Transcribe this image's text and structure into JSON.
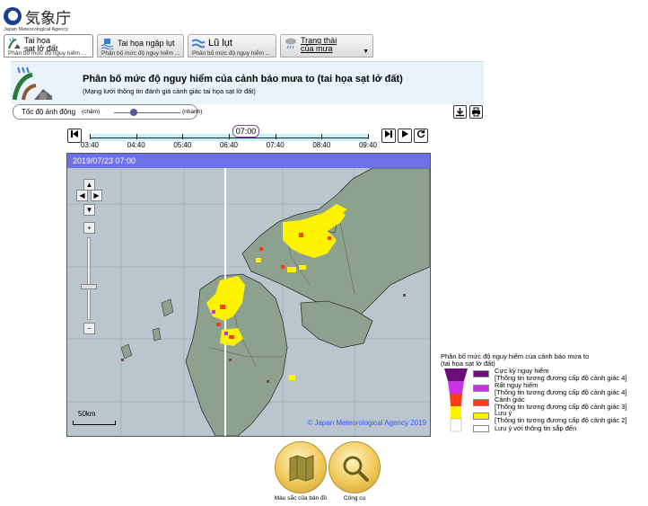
{
  "header": {
    "logo_jp": "気象庁",
    "logo_en": "Japan Meteorological Agency"
  },
  "tabs": [
    {
      "title_line1": "Tai họa",
      "title_line2": "sạt lở đất",
      "sub": "Phân bố mức độ nguy hiểm ...",
      "active": true
    },
    {
      "title": "Tai họa ngập lụt",
      "sub": "Phân bố mức độ nguy hiểm ..."
    },
    {
      "title": "Lũ lụt",
      "sub": "Phân bố mức độ nguy hiểm ..."
    },
    {
      "title_line1": "Trạng thái",
      "title_line2": "của mưa",
      "arrow": "▼"
    }
  ],
  "page": {
    "title": "Phân bố mức độ nguy hiểm của cảnh báo mưa to (tai họa sạt lở đất)",
    "subtitle": "(Mạng lưới thông tin đánh giá cảnh giác tai họa sạt lở đất)"
  },
  "speed": {
    "label": "Tốc độ ảnh động",
    "slow": "(chậm)",
    "fast": "(nhanh)",
    "level": 0.3
  },
  "toolbar": {
    "download_icon": "download-icon",
    "print_icon": "print-icon"
  },
  "timeline": {
    "current": "07:00",
    "ticks": [
      "03:40",
      "04:40",
      "05:40",
      "06:40",
      "07:40",
      "08:40",
      "09:40"
    ],
    "buttons": {
      "first": "first-frame-icon",
      "last": "last-frame-icon",
      "play": "play-icon",
      "refresh": "refresh-icon"
    }
  },
  "map": {
    "datetime": "2019/07/23 07:00",
    "copyright": "© Japan Meteorological Agency 2019",
    "scale": "50km",
    "zoom_in": "+",
    "zoom_out": "−",
    "zoom_level": 0.6
  },
  "legend": {
    "title_line1": "Phân bố mức độ nguy hiểm của cảnh báo mưa to",
    "title_line2": "(tai họa sạt lở đất)",
    "items": [
      {
        "label": "Cực kỳ nguy hiểm",
        "note": "[Thông tin tương đương cấp độ cảnh giác 4]",
        "color": "#6a0f7a"
      },
      {
        "label": "Rất nguy hiểm",
        "note": "[Thông tin tương đương cấp độ cảnh giác 4]",
        "color": "#c833e6"
      },
      {
        "label": "Cảnh giác",
        "note": "[Thông tin tương đương cấp độ cảnh giác 3]",
        "color": "#ff3a16"
      },
      {
        "label": "Lưu ý",
        "note": "[Thông tin tương đương cấp độ cảnh giác 2]",
        "color": "#fff200"
      },
      {
        "label": "Lưu ý với thông tin sắp đến",
        "color": "#ffffff"
      }
    ]
  },
  "bottom_buttons": {
    "map_color": "Màu sắc của bản đồ",
    "tools": "Công cụ"
  }
}
